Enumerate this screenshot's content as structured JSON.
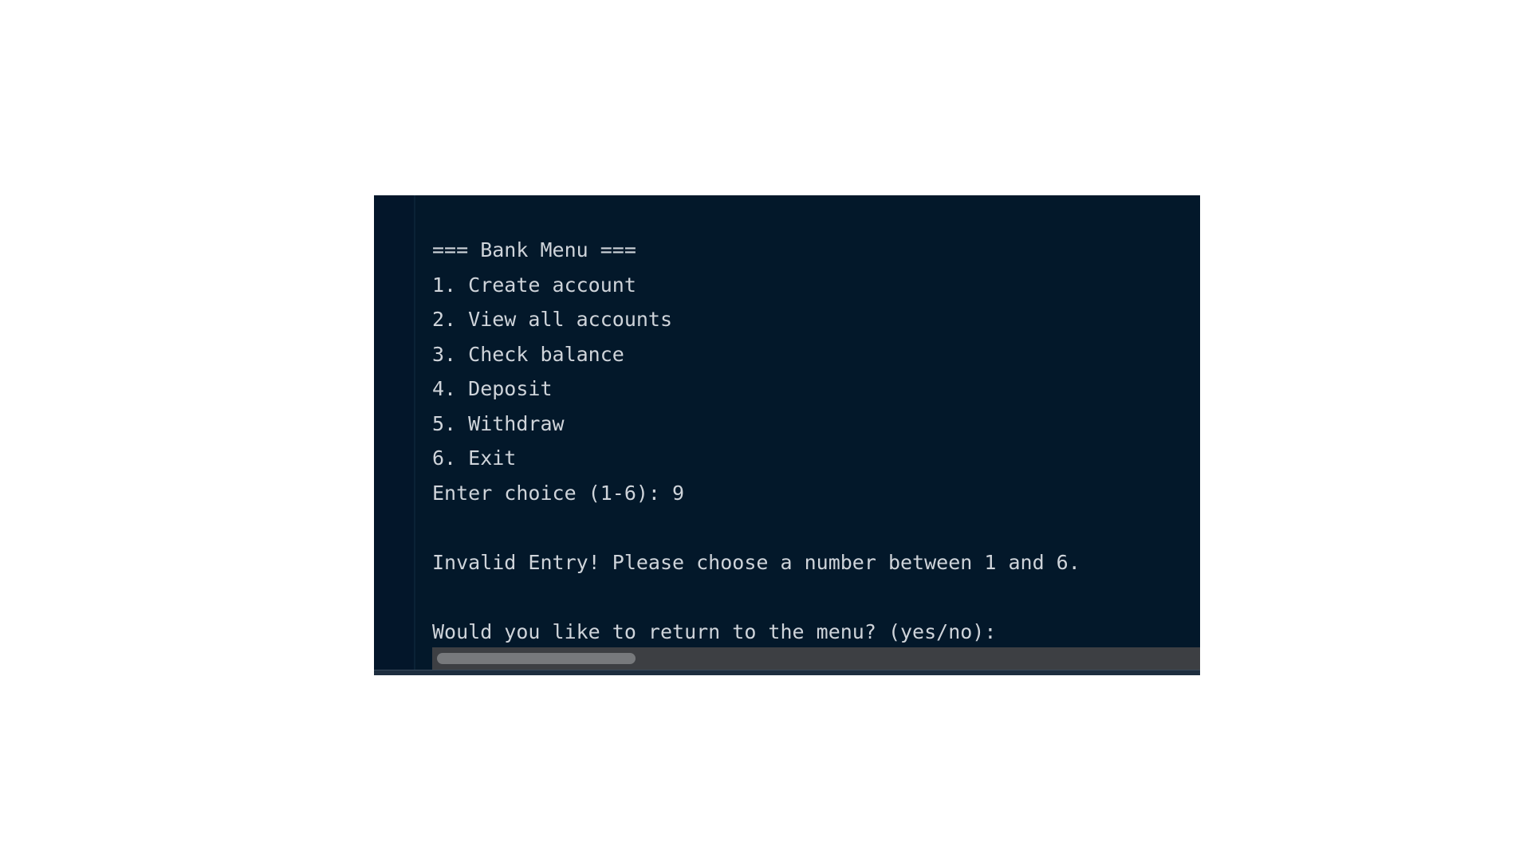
{
  "console": {
    "lines": [
      "=== Bank Menu ===",
      "1. Create account",
      "2. View all accounts",
      "3. Check balance",
      "4. Deposit",
      "5. Withdraw",
      "6. Exit",
      "Enter choice (1-6): 9",
      "",
      "Invalid Entry! Please choose a number between 1 and 6.",
      "",
      "Would you like to return to the menu? (yes/no):"
    ]
  },
  "colors": {
    "background": "#03182a",
    "text": "#cfd4da",
    "scrollbar_track": "#3d3f43",
    "scrollbar_thumb": "#77797c"
  }
}
